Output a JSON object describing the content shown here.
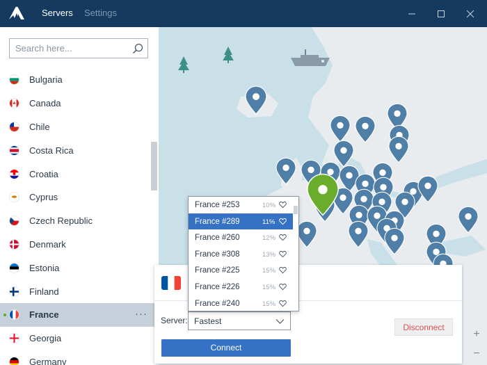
{
  "nav": {
    "servers_label": "Servers",
    "settings_label": "Settings"
  },
  "search": {
    "placeholder": "Search here..."
  },
  "countries": [
    {
      "name": "Bulgaria",
      "flag": "flag-bulgaria"
    },
    {
      "name": "Canada",
      "flag": "flag-canada"
    },
    {
      "name": "Chile",
      "flag": "flag-chile"
    },
    {
      "name": "Costa Rica",
      "flag": "flag-costa-rica"
    },
    {
      "name": "Croatia",
      "flag": "flag-croatia"
    },
    {
      "name": "Cyprus",
      "flag": "flag-cyprus"
    },
    {
      "name": "Czech Republic",
      "flag": "flag-czech-republic"
    },
    {
      "name": "Denmark",
      "flag": "flag-denmark"
    },
    {
      "name": "Estonia",
      "flag": "flag-estonia"
    },
    {
      "name": "Finland",
      "flag": "flag-finland"
    },
    {
      "name": "France",
      "flag": "flag-france",
      "selected": true,
      "more_label": "···"
    },
    {
      "name": "Georgia",
      "flag": "flag-georgia"
    },
    {
      "name": "Germany",
      "flag": "flag-germany"
    }
  ],
  "map": {
    "zoom_in": "+",
    "zoom_out": "−"
  },
  "connection": {
    "server_label": "Server:",
    "server_value": "Fastest",
    "connect_label": "Connect",
    "disconnect_label": "Disconnect"
  },
  "server_dropdown": [
    {
      "name": "France #253",
      "load": "10%"
    },
    {
      "name": "France #289",
      "load": "11%",
      "active": true
    },
    {
      "name": "France #260",
      "load": "12%"
    },
    {
      "name": "France #308",
      "load": "13%"
    },
    {
      "name": "France #225",
      "load": "15%"
    },
    {
      "name": "France #226",
      "load": "15%"
    },
    {
      "name": "France #240",
      "load": "15%"
    }
  ],
  "colors": {
    "titlebar": "#163a5f",
    "accent_blue": "#3572c4",
    "pin": "#4f7ea6",
    "pin_active": "#6aad2c",
    "disconnect_text": "#e14d4d",
    "map_water": "#c9e0e8",
    "map_land": "#e8ecef"
  }
}
